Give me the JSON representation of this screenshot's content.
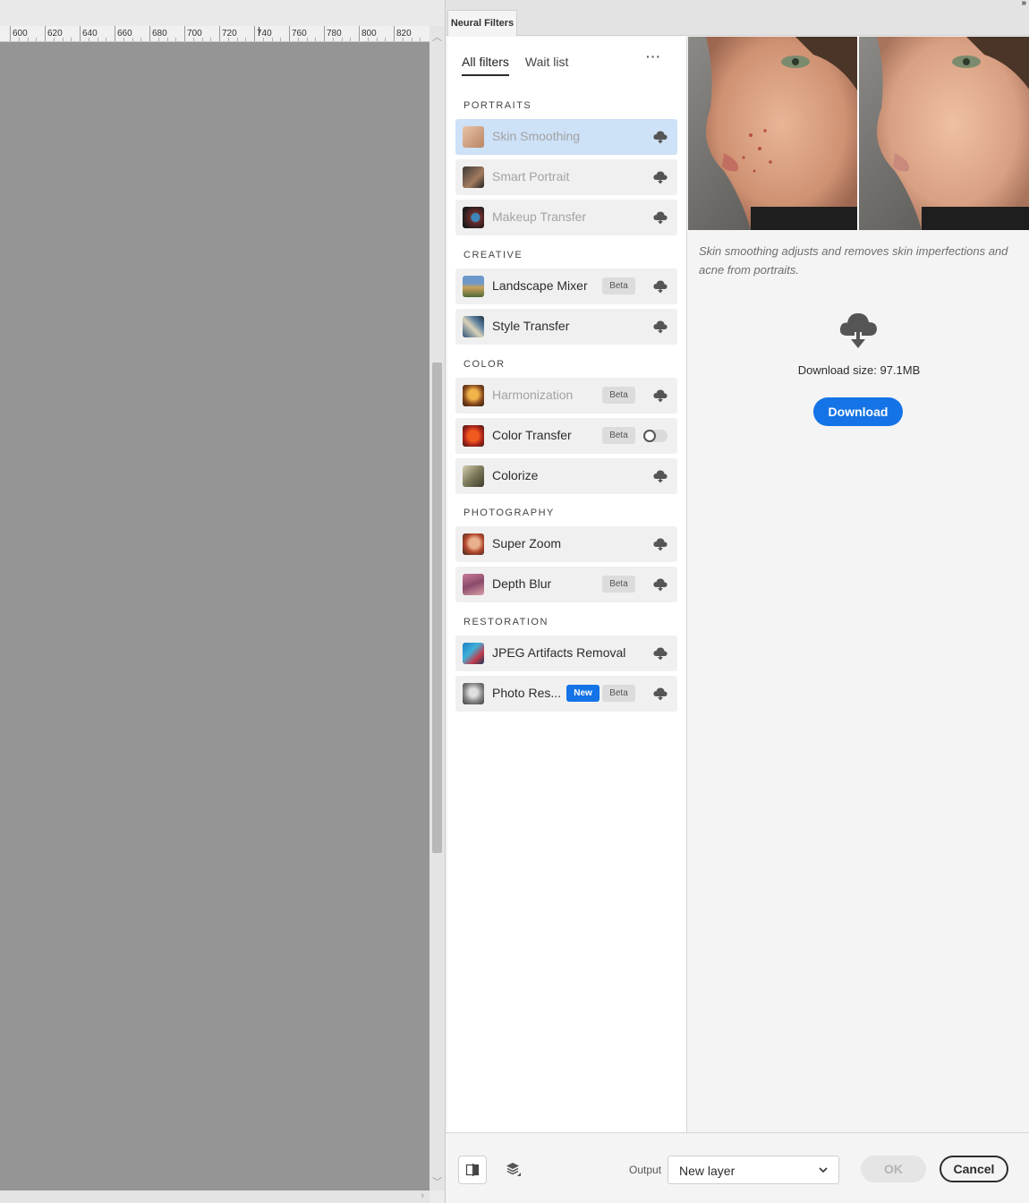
{
  "ruler": {
    "ticks": [
      "600",
      "620",
      "640",
      "660",
      "680",
      "700",
      "720",
      "740",
      "760",
      "780",
      "800",
      "820"
    ]
  },
  "panel": {
    "tab_title": "Neural Filters",
    "collapse_label": "»"
  },
  "filter_list": {
    "tabs": [
      {
        "label": "All filters",
        "active": true
      },
      {
        "label": "Wait list",
        "active": false
      }
    ],
    "more_label": "···",
    "sections": [
      {
        "title": "PORTRAITS",
        "items": [
          {
            "label": "Skin Smoothing",
            "state": "selected-disabled",
            "action": "download",
            "thumb": "skin-smoothing-thumb"
          },
          {
            "label": "Smart Portrait",
            "state": "disabled",
            "action": "download",
            "thumb": "smart-portrait-thumb"
          },
          {
            "label": "Makeup Transfer",
            "state": "disabled",
            "action": "download",
            "thumb": "makeup-transfer-thumb"
          }
        ]
      },
      {
        "title": "CREATIVE",
        "items": [
          {
            "label": "Landscape Mixer",
            "badges": [
              "Beta"
            ],
            "action": "download",
            "thumb": "landscape-mixer-thumb"
          },
          {
            "label": "Style Transfer",
            "action": "download",
            "thumb": "style-transfer-thumb"
          }
        ]
      },
      {
        "title": "COLOR",
        "items": [
          {
            "label": "Harmonization",
            "state": "disabled",
            "badges": [
              "Beta"
            ],
            "action": "download",
            "thumb": "harmonization-thumb"
          },
          {
            "label": "Color Transfer",
            "badges": [
              "Beta"
            ],
            "action": "toggle",
            "toggle_on": false,
            "thumb": "color-transfer-thumb"
          },
          {
            "label": "Colorize",
            "action": "download",
            "thumb": "colorize-thumb"
          }
        ]
      },
      {
        "title": "PHOTOGRAPHY",
        "items": [
          {
            "label": "Super Zoom",
            "action": "download",
            "thumb": "super-zoom-thumb"
          },
          {
            "label": "Depth Blur",
            "badges": [
              "Beta"
            ],
            "action": "download",
            "thumb": "depth-blur-thumb"
          }
        ]
      },
      {
        "title": "RESTORATION",
        "items": [
          {
            "label": "JPEG Artifacts Removal",
            "action": "download",
            "thumb": "jpeg-artifacts-thumb"
          },
          {
            "label": "Photo Res...",
            "badges": [
              "New",
              "Beta"
            ],
            "action": "download",
            "thumb": "photo-restoration-thumb"
          }
        ]
      }
    ]
  },
  "detail": {
    "description": "Skin smoothing adjusts and removes skin imperfections and acne from portraits.",
    "download_size": "Download size: 97.1MB",
    "download_label": "Download"
  },
  "footer": {
    "output_label": "Output",
    "output_value": "New layer",
    "ok_label": "OK",
    "cancel_label": "Cancel"
  },
  "colors": {
    "accent": "#1473e6",
    "selected_row": "#cde1f7",
    "canvas": "#959595"
  }
}
